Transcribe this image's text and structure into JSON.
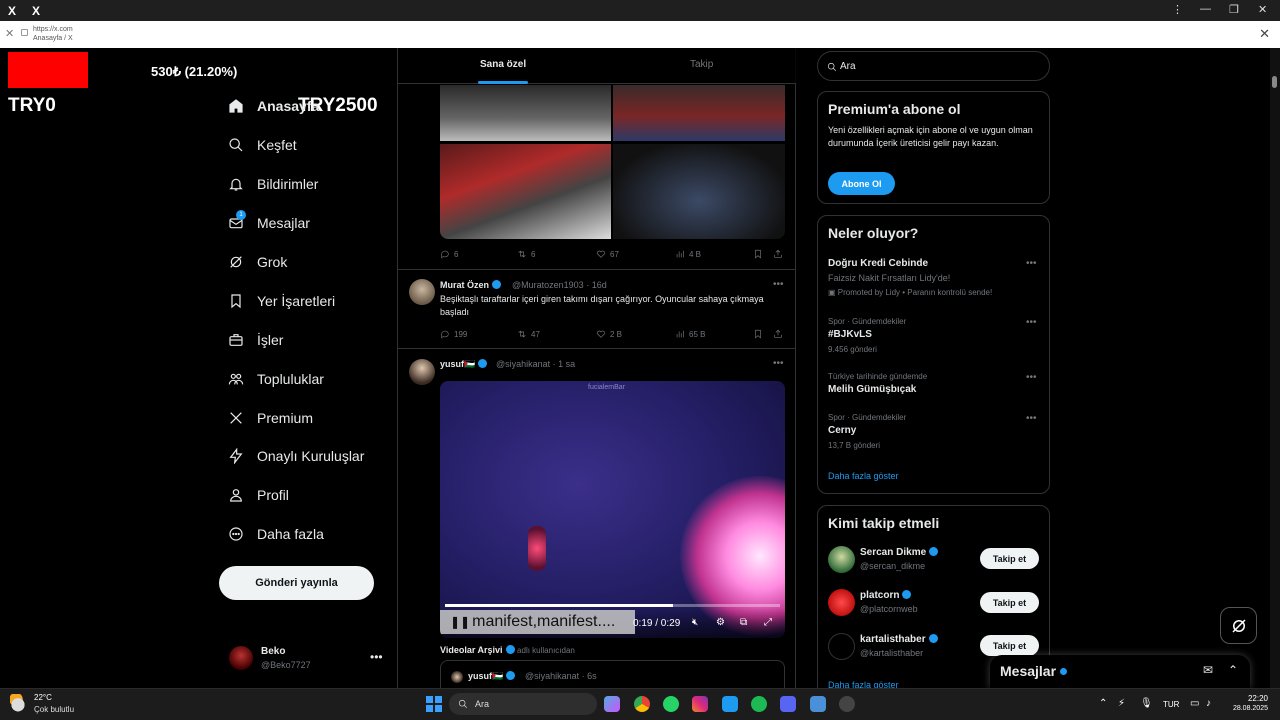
{
  "browser": {
    "url": "https://x.com",
    "tab_title": "Anasayfa / X"
  },
  "overlay": {
    "percent": "530₺ (21.20%)",
    "left_label": "TRY0",
    "right_label": "TRY2500",
    "bar_color": "#ff0000"
  },
  "nav": {
    "items": [
      {
        "label": "Anasayfa",
        "icon": "home-icon"
      },
      {
        "label": "Keşfet",
        "icon": "search-icon"
      },
      {
        "label": "Bildirimler",
        "icon": "bell-icon"
      },
      {
        "label": "Mesajlar",
        "icon": "mail-icon"
      },
      {
        "label": "Grok",
        "icon": "grok-icon"
      },
      {
        "label": "Yer İşaretleri",
        "icon": "bookmark-icon"
      },
      {
        "label": "İşler",
        "icon": "briefcase-icon"
      },
      {
        "label": "Topluluklar",
        "icon": "people-icon"
      },
      {
        "label": "Premium",
        "icon": "x-logo-icon"
      },
      {
        "label": "Onaylı Kuruluşlar",
        "icon": "lightning-icon"
      },
      {
        "label": "Profil",
        "icon": "person-icon"
      },
      {
        "label": "Daha fazla",
        "icon": "more-circle-icon"
      }
    ],
    "messages_badge": "1",
    "post_button": "Gönderi yayınla",
    "profile_name": "Beko",
    "profile_handle": "@Beko7727"
  },
  "tabs": [
    {
      "label": "Sana özel",
      "active": true
    },
    {
      "label": "Takip",
      "active": false
    }
  ],
  "tweet1_actions": {
    "reply": "6",
    "retweet": "6",
    "like": "67",
    "views": "4 B"
  },
  "tweet2": {
    "name": "Murat Özen",
    "handle": "@Muratozen1903",
    "time": "16d",
    "text": "Beşiktaşlı taraftarlar içeri giren takımı dışarı çağırıyor. Oyuncular sahaya çıkmaya başladı",
    "reply": "199",
    "retweet": "47",
    "like": "2 B",
    "views": "65 B"
  },
  "tweet3": {
    "name": "yusuf🇵🇸",
    "handle": "@siyahikanat",
    "time": "1 sa",
    "video_watermark": "fucialemBar",
    "video_subtitle": "manifest,manifest....",
    "video_time": "0:19 / 0:29",
    "video_progress": 0.68,
    "source_label": "Videolar Arşivi",
    "source_suffix": "adlı kullanıcıdan"
  },
  "quote": {
    "name": "yusuf🇵🇸",
    "handle": "@siyahikanat",
    "time": "6s"
  },
  "search": {
    "placeholder": "Ara"
  },
  "premium_card": {
    "title": "Premium'a abone ol",
    "text": "Yeni özellikleri açmak için abone ol ve uygun olman durumunda İçerik üreticisi gelir payı kazan.",
    "button": "Abone Ol"
  },
  "trends_card": {
    "title": "Neler oluyor?",
    "ad": {
      "title": "Doğru Kredi Cebinde",
      "subtitle": "Faizsiz Nakit Fırsatları Lidy'de!",
      "promoted": "Promoted by Lidy • Paranın kontrolü sende!"
    },
    "items": [
      {
        "context": "Spor · Gündemdekiler",
        "name": "#BJKvLS",
        "count": "9.456 gönderi"
      },
      {
        "context": "Türkiye tarihinde gündemde",
        "name": "Melih Gümüşbıçak",
        "count": ""
      },
      {
        "context": "Spor · Gündemdekiler",
        "name": "Cerny",
        "count": "13,7 B gönderi"
      }
    ],
    "show_more": "Daha fazla göster"
  },
  "follow_card": {
    "title": "Kimi takip etmeli",
    "users": [
      {
        "name": "Sercan Dikme",
        "handle": "@sercan_dikme",
        "button": "Takip et"
      },
      {
        "name": "platcorn",
        "handle": "@platcornweb",
        "button": "Takip et"
      },
      {
        "name": "kartalisthaber",
        "handle": "@kartalisthaber",
        "button": "Takip et"
      }
    ],
    "show_more": "Daha fazla göster"
  },
  "messages_drawer": {
    "title": "Mesajlar"
  },
  "taskbar": {
    "weather_temp": "22°C",
    "weather_desc": "Çok bulutlu",
    "search_placeholder": "Ara",
    "language": "TUR",
    "time": "22:20",
    "date": "28.08.2025"
  },
  "colors": {
    "accent": "#1d9bf0",
    "background": "#000000",
    "text": "#e7e9ea",
    "muted": "#71767b"
  }
}
